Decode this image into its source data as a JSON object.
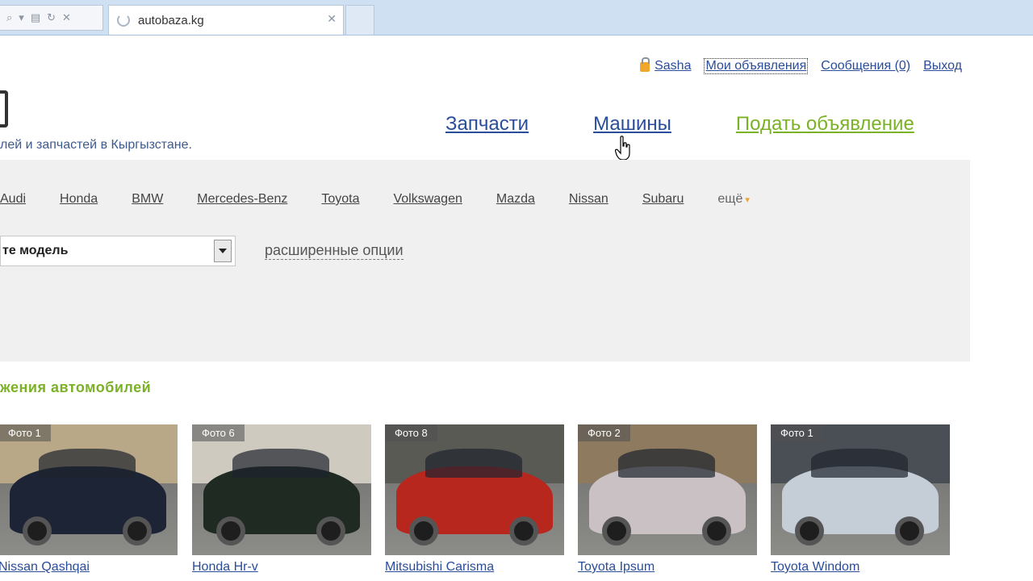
{
  "browser": {
    "tab_title": "autobaza.kg"
  },
  "user_bar": {
    "username": "Sasha",
    "my_ads": "Мои объявления",
    "messages": "Сообщения (0)",
    "logout": "Выход"
  },
  "site": {
    "tagline": "лей и запчастей в Кыргызстане."
  },
  "main_nav": {
    "parts": "Запчасти",
    "cars": "Машины",
    "post_ad": "Подать объявление"
  },
  "search": {
    "brands": [
      "Audi",
      "Honda",
      "BMW",
      "Mercedes-Benz",
      "Toyota",
      "Volkswagen",
      "Mazda",
      "Nissan",
      "Subaru"
    ],
    "more": "ещё",
    "model_select_value": "те модель",
    "advanced_options": "расширенные опции"
  },
  "section_title": "жения автомобилей",
  "cars": [
    {
      "name": "Nissan Qashqai",
      "photo_badge": "Фото 1",
      "color": "#1c2435",
      "bg": "#b9a888"
    },
    {
      "name": "Honda Hr-v",
      "photo_badge": "Фото 6",
      "color": "#1f2a22",
      "bg": "#cfcac0"
    },
    {
      "name": "Mitsubishi Carisma",
      "photo_badge": "Фото 8",
      "color": "#b8271e",
      "bg": "#5a5a55"
    },
    {
      "name": "Toyota Ipsum",
      "photo_badge": "Фото 2",
      "color": "#c9c1c4",
      "bg": "#8d7a5f"
    },
    {
      "name": "Toyota Windom",
      "photo_badge": "Фото 1",
      "color": "#c5cdd6",
      "bg": "#4a4f56"
    }
  ]
}
